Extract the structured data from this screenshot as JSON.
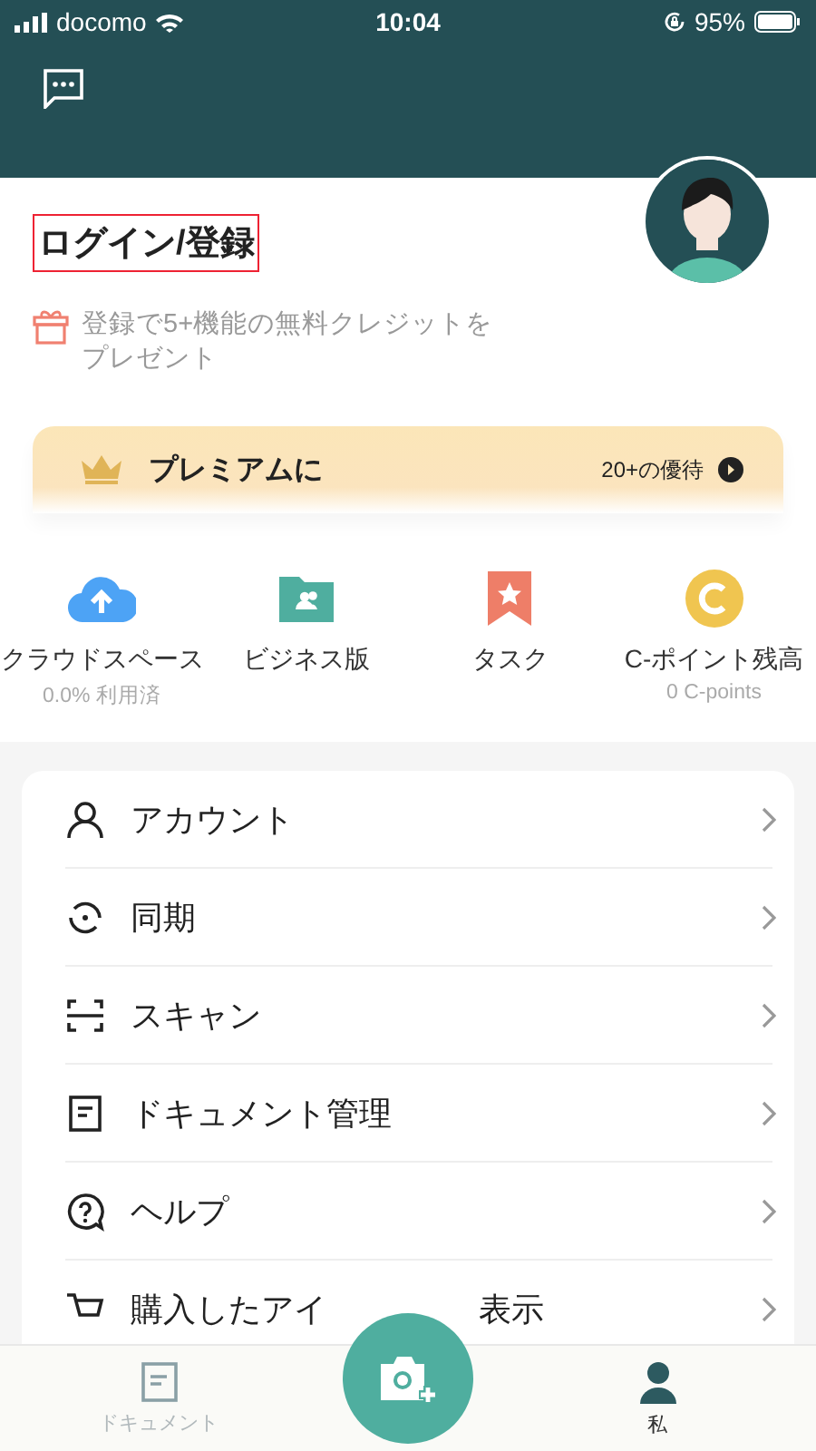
{
  "status_bar": {
    "carrier": "docomo",
    "time": "10:04",
    "battery": "95%"
  },
  "profile": {
    "login": "ログイン/登録",
    "gift_text": "登録で5+機能の無料クレジットをプレゼント"
  },
  "premium": {
    "title": "プレミアムに",
    "perks": "20+の優待"
  },
  "shortcuts": [
    {
      "kind": "cloud",
      "label": "クラウドスペース",
      "sub": "0.0% 利用済"
    },
    {
      "kind": "folder",
      "label": "ビジネス版"
    },
    {
      "kind": "bookmark",
      "label": "タスク"
    },
    {
      "kind": "coin",
      "label": "C-ポイント残高",
      "sub": "0 C-points"
    }
  ],
  "menu": [
    {
      "kind": "account",
      "label": "アカウント"
    },
    {
      "kind": "sync",
      "label": "同期"
    },
    {
      "kind": "scan",
      "label": "スキャン"
    },
    {
      "kind": "document",
      "label": "ドキュメント管理"
    },
    {
      "kind": "help",
      "label": "ヘルプ"
    },
    {
      "kind": "cart",
      "label": "購入したアイ",
      "label_tail": "表示"
    }
  ],
  "tabs": [
    {
      "kind": "document",
      "label": "ドキュメント",
      "selected": false
    },
    {
      "kind": "me",
      "label": "私",
      "selected": true
    }
  ]
}
